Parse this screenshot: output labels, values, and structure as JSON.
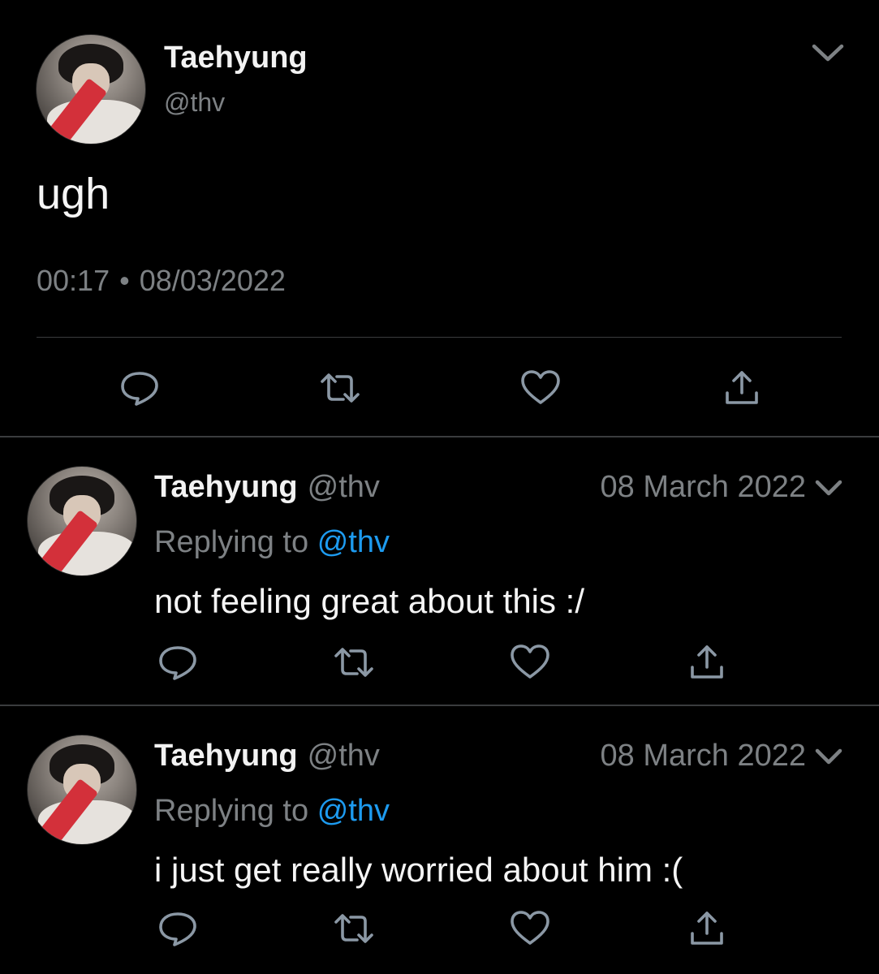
{
  "main_tweet": {
    "author_name": "Taehyung",
    "author_handle": "@thv",
    "text": "ugh",
    "time": "00:17",
    "separator": "•",
    "date": "08/03/2022",
    "icons": [
      "reply-icon",
      "retweet-icon",
      "like-icon",
      "share-icon"
    ]
  },
  "replies": [
    {
      "author_name": "Taehyung",
      "author_handle": "@thv",
      "date": "08 March 2022",
      "replying_prefix": "Replying to",
      "replying_to": "@thv",
      "text": "not feeling great about this :/"
    },
    {
      "author_name": "Taehyung",
      "author_handle": "@thv",
      "date": "08 March 2022",
      "replying_prefix": "Replying to",
      "replying_to": "@thv",
      "text": "i just get really worried about him :("
    }
  ],
  "colors": {
    "background": "#000000",
    "text": "#f5f5f5",
    "muted": "#7d8184",
    "link": "#1d9bf0",
    "divider": "#3a3c3e"
  }
}
